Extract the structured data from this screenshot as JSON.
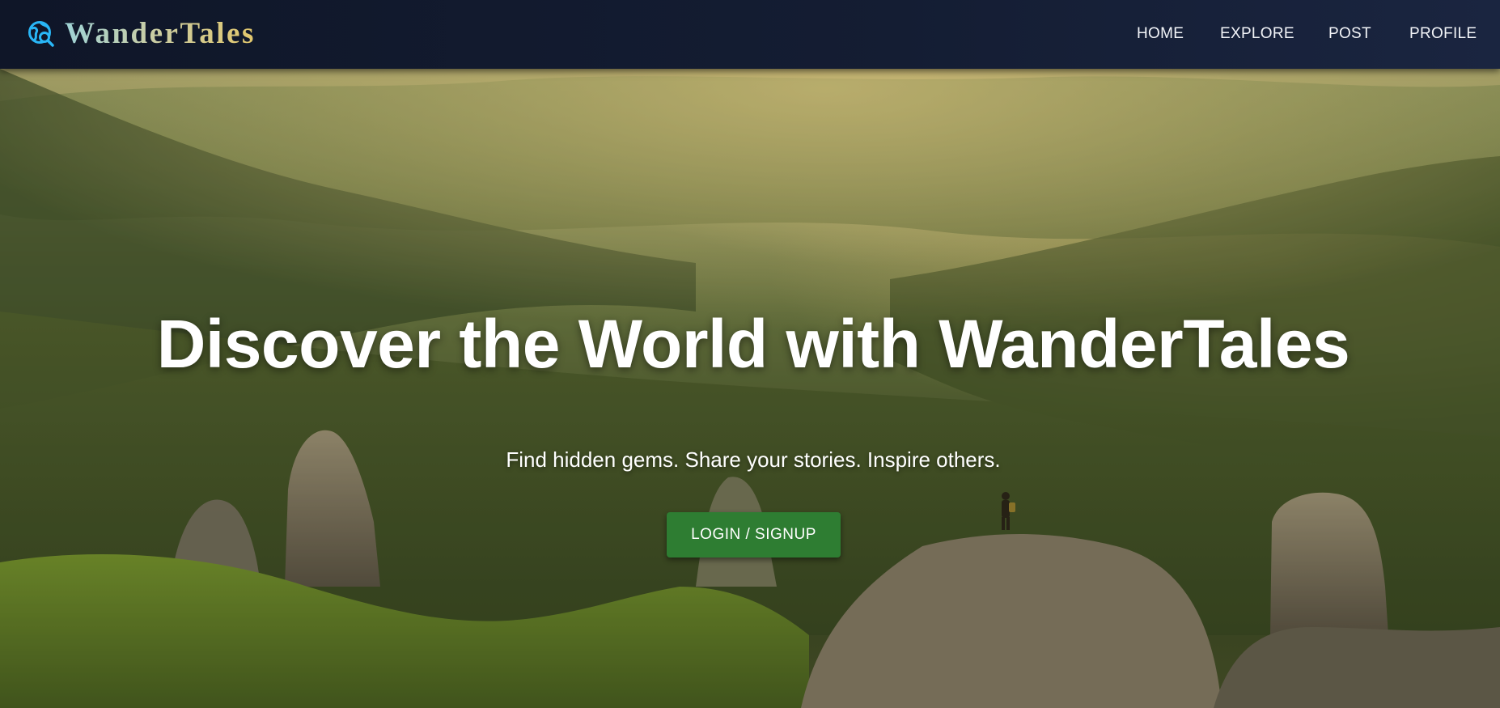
{
  "brand": {
    "name": "WanderTales",
    "icon": "globe-search-icon",
    "accent": "#29b6f6"
  },
  "nav": {
    "home": "HOME",
    "explore": "EXPLORE",
    "post": "POST",
    "profile": "PROFILE"
  },
  "hero": {
    "title": "Discover the World with WanderTales",
    "subtitle": "Find hidden gems. Share your stories. Inspire others.",
    "cta_label": "LOGIN / SIGNUP",
    "cta_color": "#2e7d32"
  }
}
